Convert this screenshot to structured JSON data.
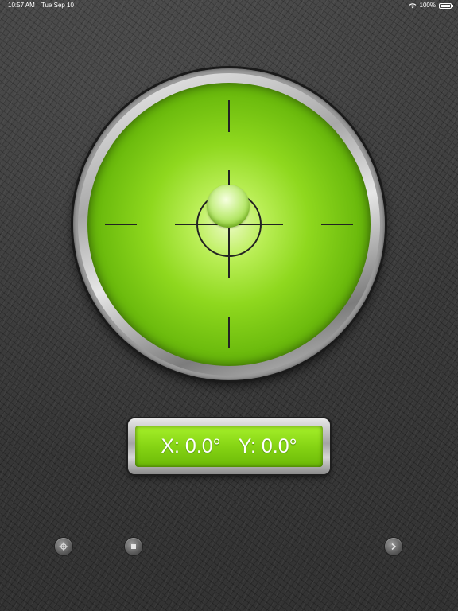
{
  "status_bar": {
    "time": "10:57 AM",
    "date": "Tue Sep 10",
    "battery": "100%",
    "battery_level": 1.0
  },
  "level": {
    "x_label": "X:",
    "x_value": "0.0°",
    "y_label": "Y:",
    "y_value": "0.0°"
  },
  "controls": [
    {
      "icon": "target-icon"
    },
    {
      "icon": "stop-icon"
    },
    {
      "icon": "chevron-right-icon"
    }
  ],
  "colors": {
    "face": "#8fd81e",
    "readout": "#86d414",
    "crosshair": "#222222"
  }
}
